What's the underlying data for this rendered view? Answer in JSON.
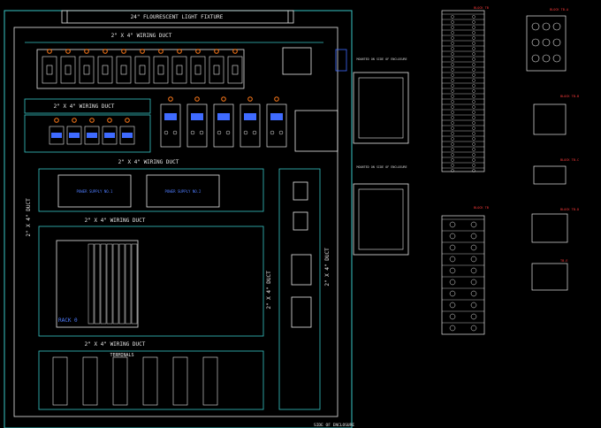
{
  "title_block": {
    "fixture_label": "24\" FLOURESCENT LIGHT FIXTURE"
  },
  "ducts": {
    "top": "2\" X 4\" WIRING DUCT",
    "upper_left": "2\" X 4\" WIRING DUCT",
    "middle": "2\" X 4\" WIRING DUCT",
    "lower": "2\" X 4\" WIRING DUCT",
    "bottom": "2\" X 4\" WIRING DUCT",
    "left_vertical": "2\" X 4\" DUCT",
    "center_vertical": "2\" X 4\" DUCT",
    "right_vertical": "2\" X 4\" DUCT"
  },
  "labels": {
    "rack": "RACK 0",
    "terminals": "TERMINALS",
    "power_supply_1": "POWER SUPPLY NO.1",
    "power_supply_2": "POWER SUPPLY NO.2",
    "side_view_1": "MOUNTED ON SIDE OF ENCLOSURE",
    "side_view_2": "MOUNTED ON SIDE OF ENCLOSURE",
    "footer": "SIDE OF ENCLOSURE"
  },
  "detail_tags": {
    "tb_top": "BLOCK TB",
    "tb_bottom": "BLOCK TB",
    "a": "BLOCK TB-A",
    "b": "BLOCK TB-B",
    "c": "BLOCK TB-C",
    "d": "BLOCK TB-D",
    "e": "TB-E"
  },
  "colors": {
    "outline": "#39c6c6",
    "line": "#e6e6e6",
    "callout": "#ff7a1a",
    "accent_blue": "#3f6bff",
    "tag_red": "#ff3b3b"
  }
}
